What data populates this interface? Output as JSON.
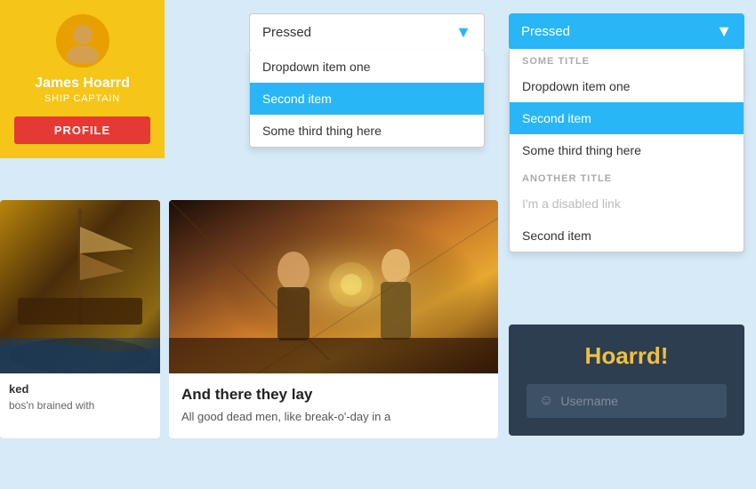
{
  "profile": {
    "name": "James Hoarrd",
    "title": "SHIP CAPTAIN",
    "button_label": "PROFILE"
  },
  "dropdown_simple": {
    "selected": "Pressed",
    "chevron": "▼",
    "items": [
      {
        "label": "Dropdown item one",
        "selected": false
      },
      {
        "label": "Second item",
        "selected": true
      },
      {
        "label": "Some third thing here",
        "selected": false
      }
    ]
  },
  "dropdown_grouped": {
    "selected": "Pressed",
    "chevron": "▼",
    "groups": [
      {
        "title": "SOME TITLE",
        "items": [
          {
            "label": "Dropdown item one",
            "selected": false,
            "disabled": false
          },
          {
            "label": "Second item",
            "selected": true,
            "disabled": false
          },
          {
            "label": "Some third thing here",
            "selected": false,
            "disabled": false
          }
        ]
      },
      {
        "title": "ANOTHER TITLE",
        "items": [
          {
            "label": "I'm a disabled link",
            "selected": false,
            "disabled": true
          },
          {
            "label": "Second item",
            "selected": false,
            "disabled": false
          }
        ]
      }
    ]
  },
  "card_middle": {
    "title": "And there they lay",
    "text": "All good dead men, like break-o'-day in a"
  },
  "card_left": {
    "title": "ked",
    "text": "bos'n brained with"
  },
  "login_card": {
    "title": "Hoarrd!",
    "username_placeholder": "Username"
  },
  "colors": {
    "blue": "#29b6f6",
    "yellow": "#f5c518",
    "red": "#e53935",
    "dark": "#2c3e50"
  }
}
